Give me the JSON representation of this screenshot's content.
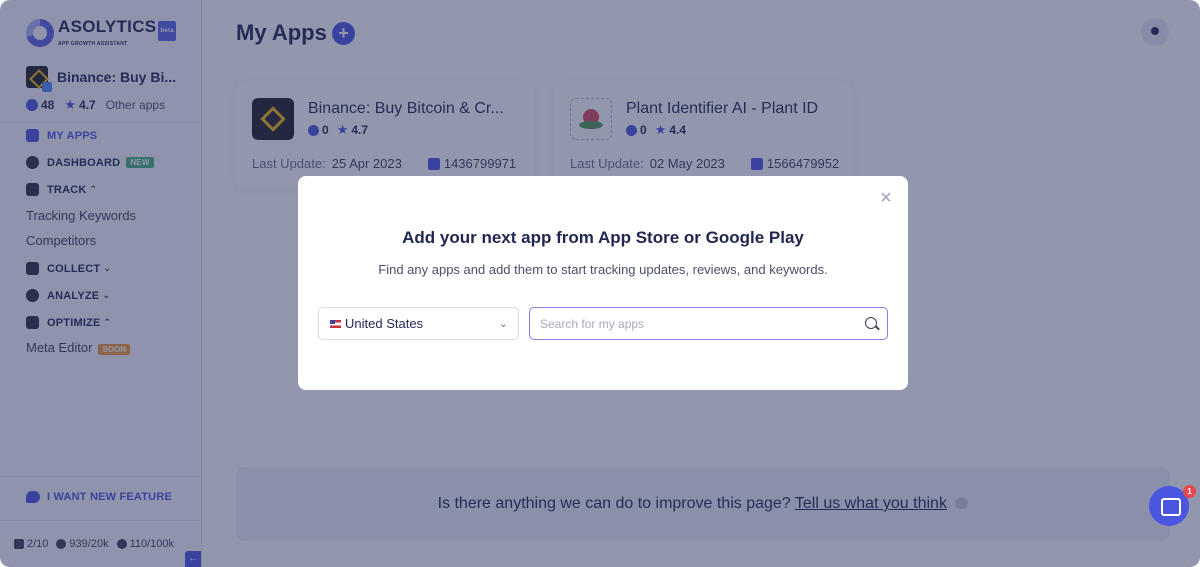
{
  "logo": {
    "name": "ASOLYTICS",
    "beta": "beta",
    "tagline": "APP GROWTH ASSISTANT"
  },
  "current_app": {
    "name": "Binance: Buy Bi...",
    "count": "48",
    "rating": "4.7",
    "other_apps": "Other apps"
  },
  "nav": {
    "my_apps": "MY APPS",
    "dashboard": "DASHBOARD",
    "dashboard_badge": "NEW",
    "track": "TRACK",
    "tracking_keywords": "Tracking Keywords",
    "competitors": "Competitors",
    "collect": "COLLECT",
    "analyze": "ANALYZE",
    "optimize": "OPTIMIZE",
    "meta_editor": "Meta Editor",
    "meta_editor_badge": "SOON"
  },
  "feature_request": "I WANT NEW FEATURE",
  "limits": {
    "apps": "2/10",
    "keywords": "939/20k",
    "other": "110/100k"
  },
  "header": {
    "title": "My Apps",
    "add": "+"
  },
  "apps": [
    {
      "name": "Binance: Buy Bitcoin & Cr...",
      "count": "0",
      "rating": "4.7",
      "last_update_label": "Last Update:",
      "last_update": "25 Apr 2023",
      "app_id": "1436799971"
    },
    {
      "name": "Plant Identifier AI - Plant ID",
      "count": "0",
      "rating": "4.4",
      "last_update_label": "Last Update:",
      "last_update": "02 May 2023",
      "app_id": "1566479952"
    }
  ],
  "feedback": {
    "text": "Is there anything we can do to improve this page?",
    "link": "Tell us what you think"
  },
  "chat": {
    "badge": "1"
  },
  "modal": {
    "title": "Add your next app from App Store or Google Play",
    "subtitle": "Find any apps and add them to start tracking updates, reviews, and keywords.",
    "country": "United States",
    "search_placeholder": "Search for my apps",
    "close": "×"
  },
  "colors": {
    "accent": "#4a55e0",
    "overlay": "#28305c",
    "new_badge": "#49b27c",
    "soon_badge": "#f39a3b"
  }
}
